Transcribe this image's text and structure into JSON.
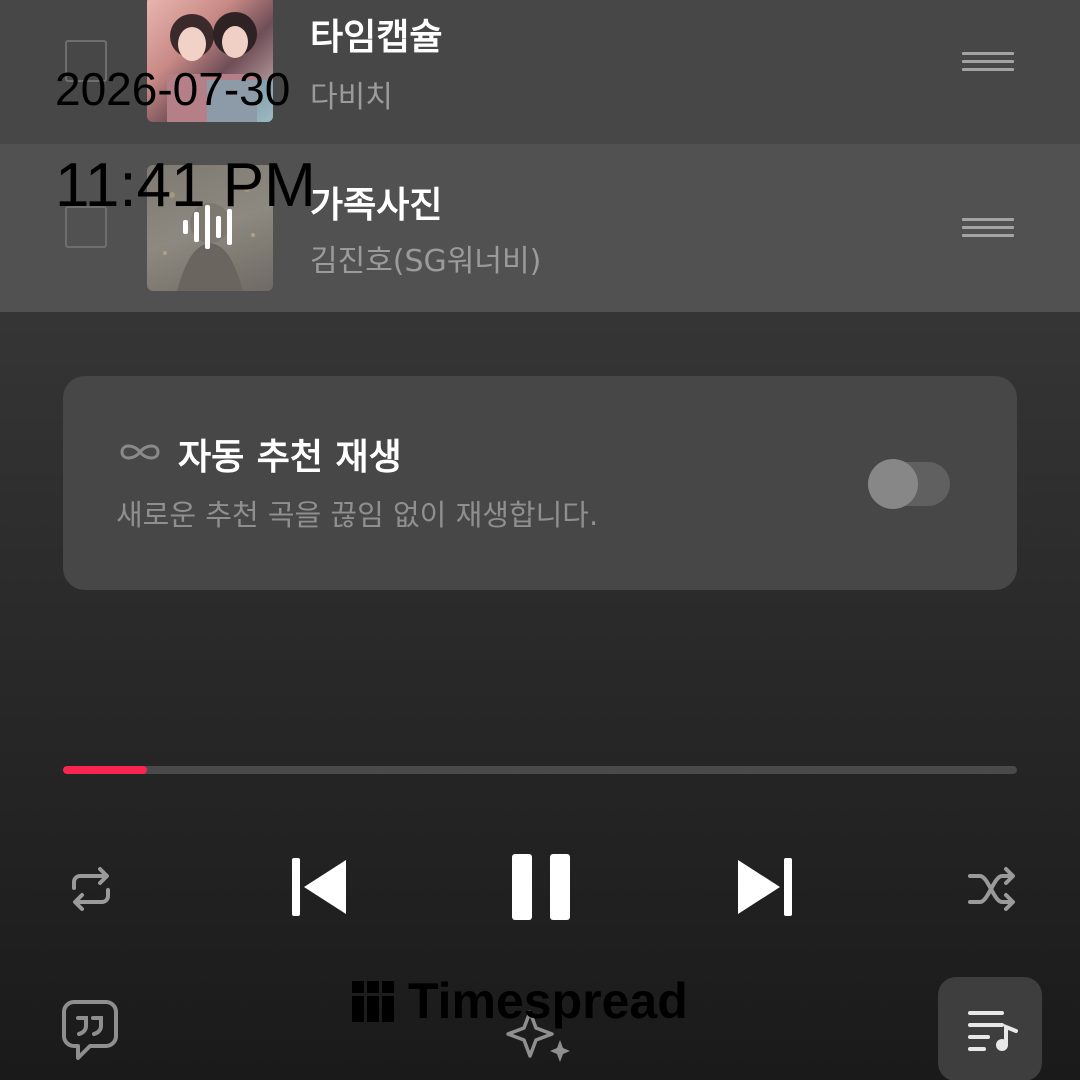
{
  "queue": [
    {
      "title": "타임캡슐",
      "artist": "다비치",
      "selected": false,
      "now_playing": false
    },
    {
      "title": "가족사진",
      "artist": "김진호(SG워너비)",
      "selected": false,
      "now_playing": true
    }
  ],
  "overlay": {
    "date": "2026-07-30",
    "time": "11:41 PM"
  },
  "autoplay": {
    "title": "자동 추천 재생",
    "description": "새로운 추천 곡을 끊임 없이 재생합니다.",
    "enabled": false
  },
  "player": {
    "progress_fraction": 0.088,
    "accent_color": "#f7254f"
  },
  "watermark": {
    "text": "Timespread"
  },
  "icons": {
    "repeat": "repeat-icon",
    "previous": "skip-previous-icon",
    "pause": "pause-icon",
    "next": "skip-next-icon",
    "shuffle": "shuffle-icon",
    "lyrics": "quote-bubble-icon",
    "recommend": "sparkle-icon",
    "queue": "playlist-music-icon"
  }
}
